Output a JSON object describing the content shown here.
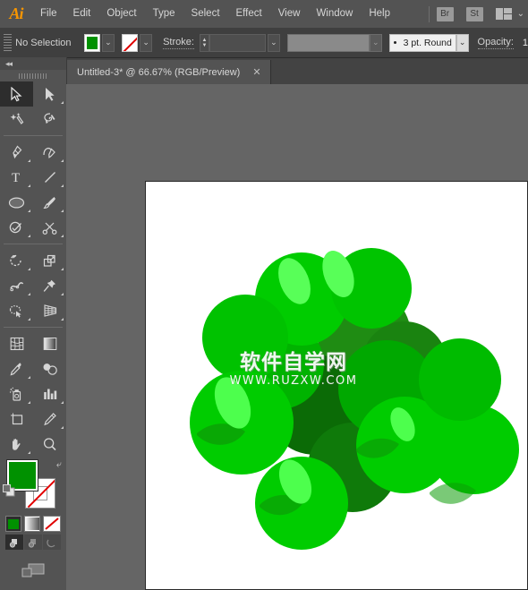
{
  "app": {
    "logo": "Ai",
    "menus": [
      "File",
      "Edit",
      "Object",
      "Type",
      "Select",
      "Effect",
      "View",
      "Window",
      "Help"
    ],
    "right_buttons": [
      {
        "label": "Br",
        "name": "bridge-button"
      },
      {
        "label": "St",
        "name": "stock-button"
      }
    ],
    "workspace_chevron": "⌄"
  },
  "control_bar": {
    "selection_status": "No Selection",
    "fill_color": "#009100",
    "fill_chevron": "⌄",
    "stroke_color": "none",
    "stroke_chevron": "⌄",
    "stroke_label": "Stroke:",
    "stroke_weight": "",
    "stroke_weight_chevron": "⌄",
    "profile_value": "",
    "profile_chevron": "⌄",
    "brush_preset": "3 pt. Round",
    "brush_chevron": "⌄",
    "opacity_label": "Opacity:",
    "opacity_value": "1",
    "stepper_up": "▲",
    "stepper_down": "▼"
  },
  "tabs": {
    "collapse_icon": "◂◂",
    "documents": [
      {
        "title": "Untitled-3* @ 66.67% (RGB/Preview)",
        "close": "✕",
        "active": true
      }
    ]
  },
  "tools": {
    "items": [
      {
        "name": "selection-tool",
        "label": "Selection",
        "active": true,
        "has_corner": false
      },
      {
        "name": "direct-selection-tool",
        "label": "Direct Selection",
        "active": false,
        "has_corner": true
      },
      {
        "name": "magic-wand-tool",
        "label": "Magic Wand",
        "active": false,
        "has_corner": false
      },
      {
        "name": "lasso-tool",
        "label": "Lasso",
        "active": false,
        "has_corner": false
      },
      {
        "name": "pen-tool",
        "label": "Pen",
        "active": false,
        "has_corner": true
      },
      {
        "name": "curvature-tool",
        "label": "Curvature",
        "active": false,
        "has_corner": true
      },
      {
        "name": "type-tool",
        "label": "Type",
        "active": false,
        "has_corner": true
      },
      {
        "name": "line-segment-tool",
        "label": "Line Segment",
        "active": false,
        "has_corner": true
      },
      {
        "name": "ellipse-tool",
        "label": "Ellipse",
        "active": false,
        "has_corner": true
      },
      {
        "name": "paintbrush-tool",
        "label": "Paintbrush",
        "active": false,
        "has_corner": true
      },
      {
        "name": "shaper-tool",
        "label": "Shaper",
        "active": false,
        "has_corner": true
      },
      {
        "name": "scissors-tool",
        "label": "Scissors",
        "active": false,
        "has_corner": true
      },
      {
        "name": "rotate-tool",
        "label": "Rotate",
        "active": false,
        "has_corner": true
      },
      {
        "name": "scale-tool",
        "label": "Scale",
        "active": false,
        "has_corner": true
      },
      {
        "name": "width-tool",
        "label": "Width",
        "active": false,
        "has_corner": true
      },
      {
        "name": "free-transform-tool",
        "label": "Free Transform",
        "active": false,
        "has_corner": true
      },
      {
        "name": "shape-builder-tool",
        "label": "Shape Builder",
        "active": false,
        "has_corner": true
      },
      {
        "name": "perspective-grid-tool",
        "label": "Perspective Grid",
        "active": false,
        "has_corner": true
      },
      {
        "name": "mesh-tool",
        "label": "Mesh",
        "active": false,
        "has_corner": false
      },
      {
        "name": "gradient-tool",
        "label": "Gradient",
        "active": false,
        "has_corner": false
      },
      {
        "name": "eyedropper-tool",
        "label": "Eyedropper",
        "active": false,
        "has_corner": true
      },
      {
        "name": "blend-tool",
        "label": "Blend",
        "active": false,
        "has_corner": false
      },
      {
        "name": "symbol-sprayer-tool",
        "label": "Symbol Sprayer",
        "active": false,
        "has_corner": true
      },
      {
        "name": "column-graph-tool",
        "label": "Column Graph",
        "active": false,
        "has_corner": true
      },
      {
        "name": "artboard-tool",
        "label": "Artboard",
        "active": false,
        "has_corner": false
      },
      {
        "name": "slice-tool",
        "label": "Slice",
        "active": false,
        "has_corner": true
      },
      {
        "name": "hand-tool",
        "label": "Hand",
        "active": false,
        "has_corner": true
      },
      {
        "name": "zoom-tool",
        "label": "Zoom",
        "active": false,
        "has_corner": false
      }
    ],
    "fill_color": "#009100",
    "stroke_color": "none",
    "swap_icon": "⤶",
    "color_modes": [
      "color-mode",
      "gradient-mode",
      "none-mode"
    ],
    "draw_modes": [
      "draw-normal",
      "draw-behind",
      "draw-inside"
    ]
  },
  "canvas": {
    "background": "#656565",
    "artboard_color": "#ffffff",
    "zoom_level": "66.67%",
    "watermark_cn": "软件自学网",
    "watermark_en": "WWW.RUZXW.COM",
    "artwork": {
      "name": "green-grape-cluster",
      "colors": {
        "bright": "#00cc00",
        "mid": "#00b300",
        "dark": "#1f8c13",
        "darkest": "#0d6b08",
        "highlight": "#5cff5c"
      }
    }
  }
}
